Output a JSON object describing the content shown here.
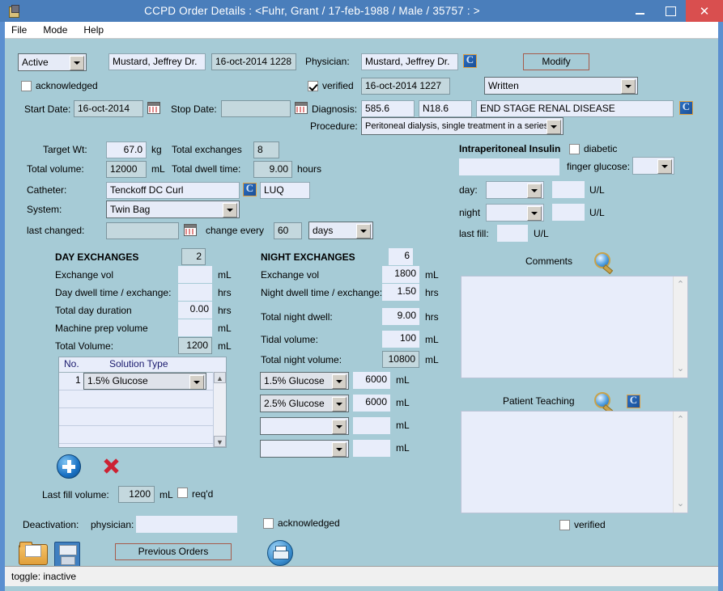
{
  "window": {
    "title": "CCPD Order Details :   <Fuhr, Grant  / 17-feb-1988 / Male / 35757 : >",
    "icon": "app-icon",
    "minimize": "–",
    "maximize": "□",
    "close": "✕"
  },
  "menu": {
    "items": [
      "File",
      "Mode",
      "Help"
    ]
  },
  "status": {
    "text": "toggle: inactive"
  },
  "header": {
    "status_select": "Active",
    "entered_by": "Mustard, Jeffrey Dr.",
    "entered_datetime": "16-oct-2014 1228",
    "physician_label": "Physician:",
    "physician_value": "Mustard, Jeffrey Dr.",
    "modify_button": "Modify",
    "acknowledged_label": "acknowledged",
    "acknowledged_checked": false,
    "verified_label": "verified",
    "verified_checked": true,
    "verified_datetime": "16-oct-2014 1227",
    "order_type": "Written",
    "start_date_label": "Start Date:",
    "start_date": "16-oct-2014",
    "stop_date_label": "Stop Date:",
    "stop_date": "",
    "diagnosis_label": "Diagnosis:",
    "diagnosis_code1": "585.6",
    "diagnosis_code2": "N18.6",
    "diagnosis_text": "END STAGE RENAL DISEASE",
    "procedure_label": "Procedure:",
    "procedure_value": "Peritoneal dialysis, single treatment in a series"
  },
  "prescription": {
    "target_wt_label": "Target Wt:",
    "target_wt": "67.0",
    "target_wt_unit": "kg",
    "total_exchanges_label": "Total exchanges",
    "total_exchanges": "8",
    "total_volume_label": "Total volume:",
    "total_volume": "12000",
    "total_volume_unit": "mL",
    "total_dwell_label": "Total dwell time:",
    "total_dwell": "9.00",
    "total_dwell_unit": "hours",
    "catheter_label": "Catheter:",
    "catheter": "Tenckoff DC Curl",
    "catheter_site": "LUQ",
    "system_label": "System:",
    "system": "Twin Bag",
    "last_changed_label": "last changed:",
    "last_changed": "",
    "change_every_label": "change every",
    "change_every": "60",
    "change_every_unit": "days"
  },
  "insulin": {
    "title": "Intraperitoneal Insulin",
    "diabetic_label": "diabetic",
    "diabetic_checked": false,
    "insulin_type": "",
    "finger_glucose_label": "finger glucose:",
    "finger_glucose": "",
    "day_label": "day:",
    "day_select": "",
    "day_value": "",
    "day_unit": "U/L",
    "night_label": "night",
    "night_select": "",
    "night_value": "",
    "night_unit": "U/L",
    "last_fill_label": "last fill:",
    "last_fill": "",
    "last_fill_unit": "U/L"
  },
  "day_exchanges": {
    "title": "DAY EXCHANGES",
    "count": "2",
    "rows": [
      {
        "label": "Exchange vol",
        "value": "",
        "unit": "mL"
      },
      {
        "label": "Day dwell time / exchange:",
        "value": "",
        "unit": "hrs"
      },
      {
        "label": "Total day duration",
        "value": "0.00",
        "unit": "hrs"
      },
      {
        "label": "Machine prep volume",
        "value": "",
        "unit": "mL"
      },
      {
        "label": "Total Volume:",
        "value": "1200",
        "unit": "mL"
      }
    ],
    "table": {
      "col_no": "No.",
      "col_solution": "Solution Type",
      "rows": [
        {
          "no": "1",
          "solution": "1.5% Glucose"
        },
        {
          "no": "",
          "solution": ""
        },
        {
          "no": "",
          "solution": ""
        },
        {
          "no": "",
          "solution": ""
        }
      ]
    },
    "add_icon": "add-icon",
    "delete_icon": "delete-icon",
    "last_fill_label": "Last fill volume:",
    "last_fill_volume": "1200",
    "last_fill_unit": "mL",
    "reqd_label": "req'd",
    "reqd_checked": false
  },
  "night_exchanges": {
    "title": "NIGHT EXCHANGES",
    "count": "6",
    "rows": [
      {
        "label": "Exchange vol",
        "value": "1800",
        "unit": "mL"
      },
      {
        "label": "Night dwell time / exchange:",
        "value": "1.50",
        "unit": "hrs"
      },
      {
        "label": "Total night dwell:",
        "value": "9.00",
        "unit": "hrs"
      },
      {
        "label": "Tidal volume:",
        "value": "100",
        "unit": "mL"
      },
      {
        "label": "Total night volume:",
        "value": "10800",
        "unit": "mL"
      }
    ],
    "solutions": [
      {
        "solution": "1.5% Glucose",
        "volume": "6000",
        "unit": "mL"
      },
      {
        "solution": "2.5% Glucose",
        "volume": "6000",
        "unit": "mL"
      },
      {
        "solution": "",
        "volume": "",
        "unit": "mL"
      },
      {
        "solution": "",
        "volume": "",
        "unit": "mL"
      }
    ]
  },
  "comments": {
    "label": "Comments",
    "value": "",
    "search_icon": "magnifier-icon"
  },
  "patient_teaching": {
    "label": "Patient Teaching",
    "value": "",
    "search_icon": "magnifier-icon",
    "reference_icon": "reference-icon",
    "verified_label": "verified",
    "verified_checked": false
  },
  "footer": {
    "deactivation_label": "Deactivation:",
    "physician_label": "physician:",
    "physician_value": "",
    "acknowledged_label": "acknowledged",
    "acknowledged_checked": false,
    "open_icon": "folder-open-icon",
    "save_icon": "save-icon",
    "previous_orders": "Previous Orders",
    "print_icon": "print-icon"
  },
  "colors": {
    "background": "#a6cbd6",
    "titlebar": "#4a7ebb",
    "close": "#d94f4f",
    "field": "#e8edfa",
    "button_border": "#a65b4b"
  }
}
